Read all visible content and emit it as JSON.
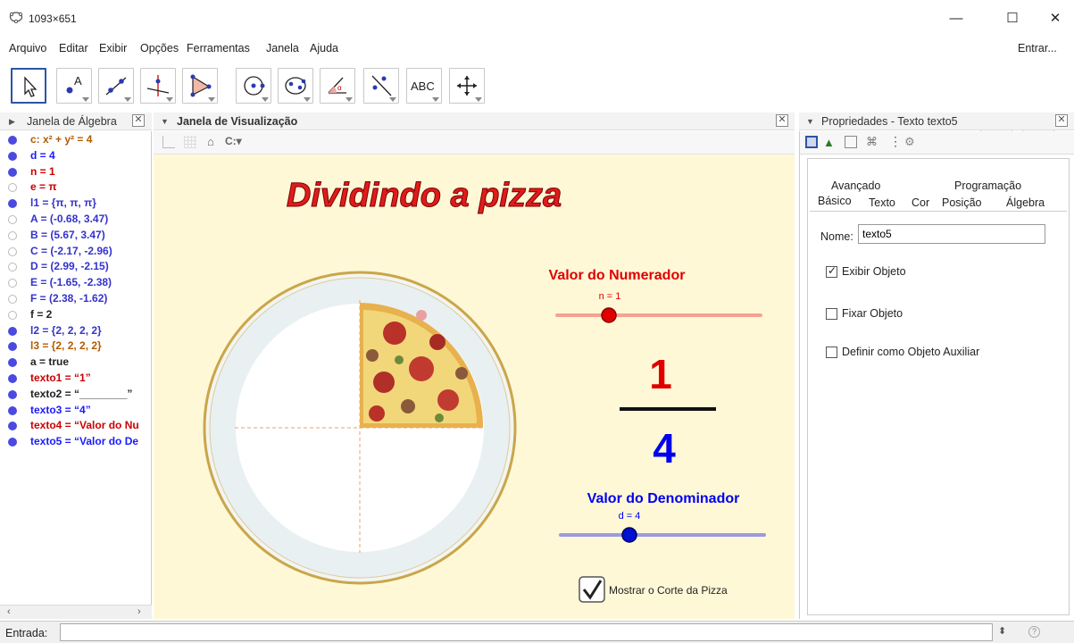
{
  "window": {
    "title": "1093×651",
    "minimize": "—",
    "maximize": "☐",
    "close": "✕"
  },
  "menu": [
    "Arquivo",
    "Editar",
    "Exibir",
    "Opções",
    "Ferramentas",
    "Janela",
    "Ajuda"
  ],
  "menu_right": "Entrar...",
  "toolbar": {
    "tools": [
      "move-tool",
      "point-tool",
      "line-tool",
      "perpendicular-tool",
      "polygon-tool",
      "circle-tool",
      "conic-tool",
      "angle-tool",
      "reflect-tool",
      "text-tool",
      "move-view-tool"
    ],
    "text_tool_label": "ABC",
    "undo": "↶",
    "redo": "↷",
    "help": "?",
    "settings": "✲"
  },
  "algebra": {
    "title": "Janela de Álgebra",
    "items": [
      {
        "text": "c: x² + y² = 4",
        "color": "#b35b00",
        "filled": true,
        "dot": "#4a4ae0"
      },
      {
        "text": "d = 4",
        "color": "#1a1aff",
        "filled": true,
        "dot": "#4a4ae0"
      },
      {
        "text": "n = 1",
        "color": "#cc0000",
        "filled": true,
        "dot": "#4a4ae0"
      },
      {
        "text": "e = π",
        "color": "#cc0000",
        "filled": false,
        "dot": "#bbb"
      },
      {
        "text": "l1 = {π, π, π}",
        "color": "#3333cc",
        "filled": true,
        "dot": "#4a4ae0"
      },
      {
        "text": "A = (-0.68, 3.47)",
        "color": "#3333cc",
        "filled": false,
        "dot": "#bbb"
      },
      {
        "text": "B = (5.67, 3.47)",
        "color": "#3333cc",
        "filled": false,
        "dot": "#bbb"
      },
      {
        "text": "C = (-2.17, -2.96)",
        "color": "#3333cc",
        "filled": false,
        "dot": "#bbb"
      },
      {
        "text": "D = (2.99, -2.15)",
        "color": "#3333cc",
        "filled": false,
        "dot": "#bbb"
      },
      {
        "text": "E = (-1.65, -2.38)",
        "color": "#3333cc",
        "filled": false,
        "dot": "#bbb"
      },
      {
        "text": "F = (2.38, -1.62)",
        "color": "#3333cc",
        "filled": false,
        "dot": "#bbb"
      },
      {
        "text": "f = 2",
        "color": "#222",
        "filled": false,
        "dot": "#bbb"
      },
      {
        "text": "l2 = {2, 2, 2, 2}",
        "color": "#3333cc",
        "filled": true,
        "dot": "#4a4ae0"
      },
      {
        "text": "l3 = {2, 2, 2, 2}",
        "color": "#b35b00",
        "filled": true,
        "dot": "#4a4ae0"
      },
      {
        "text": "a = true",
        "color": "#222",
        "filled": true,
        "dot": "#4a4ae0"
      },
      {
        "text": "texto1 = “1”",
        "color": "#cc0000",
        "filled": true,
        "dot": "#4a4ae0"
      },
      {
        "text": "texto2 = “________”",
        "color": "#222",
        "filled": true,
        "dot": "#4a4ae0"
      },
      {
        "text": "texto3 = “4”",
        "color": "#1a1aff",
        "filled": true,
        "dot": "#4a4ae0"
      },
      {
        "text": "texto4 = “Valor do Nu",
        "color": "#cc0000",
        "filled": true,
        "dot": "#4a4ae0"
      },
      {
        "text": "texto5 = “Valor do De",
        "color": "#1a1aff",
        "filled": true,
        "dot": "#4a4ae0"
      }
    ]
  },
  "graphics": {
    "title": "Janela de Visualização",
    "heading": "Dividindo a pizza",
    "numerator_label": "Valor do Numerador",
    "numerator_slider": "n = 1",
    "numerator_value": "1",
    "denominator_value": "4",
    "denominator_label": "Valor do Denominador",
    "denominator_slider": "d = 4",
    "checkbox_label": "Mostrar o Corte da Pizza",
    "numerator_fraction": 0.0,
    "denominator_fraction": 0.25
  },
  "properties": {
    "title": "Propriedades - Texto texto5",
    "tabs_top": [
      "Avançado",
      "Programação"
    ],
    "tabs_bottom": [
      "Básico",
      "Texto",
      "Cor",
      "Posição",
      "Álgebra"
    ],
    "name_label": "Nome:",
    "name_value": "texto5",
    "show_object": "Exibir Objeto",
    "fix_object": "Fixar Objeto",
    "aux_object": "Definir como Objeto Auxiliar"
  },
  "entry": {
    "label": "Entrada:",
    "help": "?"
  },
  "colors": {
    "accent": "#2b55a6",
    "numerator": "#e00000",
    "denominator": "#0000ee",
    "canvas": "#fef8d7"
  }
}
